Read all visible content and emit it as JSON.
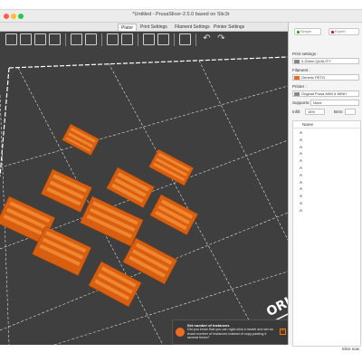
{
  "window": {
    "title": "*Untitled - PrusaSlicer-2.5.0 based on Slic3r"
  },
  "tabs": [
    {
      "label": "Plater",
      "active": true
    },
    {
      "label": "Print Settings",
      "active": false
    },
    {
      "label": "Filament Settings",
      "active": false
    },
    {
      "label": "Printer Settings",
      "active": false
    }
  ],
  "toolbar": {
    "icons": [
      "add-icon",
      "delete-icon",
      "delete-all-icon",
      "arrange-icon",
      "copy-icon",
      "paste-icon",
      "add-instance-icon",
      "remove-instance-icon",
      "split-objects-icon",
      "split-parts-icon",
      "variable-layer-icon",
      "undo-icon",
      "redo-icon"
    ]
  },
  "sidebar": {
    "mode_simple": "Simple",
    "mode_expert": "Expert",
    "print_settings_label": "Print settings :",
    "print_settings_value": "0.20mm QUALITY",
    "filament_label": "Filament :",
    "filament_value": "Generic PETG",
    "printer_label": "Printer :",
    "printer_value": "Original Prusa MINI & MINI+",
    "supports_label": "Supports:",
    "supports_value": "None",
    "infill_label": "Infill:",
    "infill_value": "15%",
    "brim_label": "Brim:",
    "list_header": "Name",
    "objects": [
      "A",
      "A",
      "A",
      "A",
      "A",
      "A",
      "A",
      "A",
      "A",
      "A",
      "A",
      "A"
    ],
    "slice_button": "Slice now"
  },
  "hint": {
    "title": "Set number of instances",
    "body": "Did you know that you can right-click a model and set an exact number of instances instead of copy-pasting it several times?"
  },
  "bed_logo": "ORI",
  "colors": {
    "accent": "#ed6b21",
    "bed": "#404040",
    "bed_lines": "#ffffff"
  }
}
